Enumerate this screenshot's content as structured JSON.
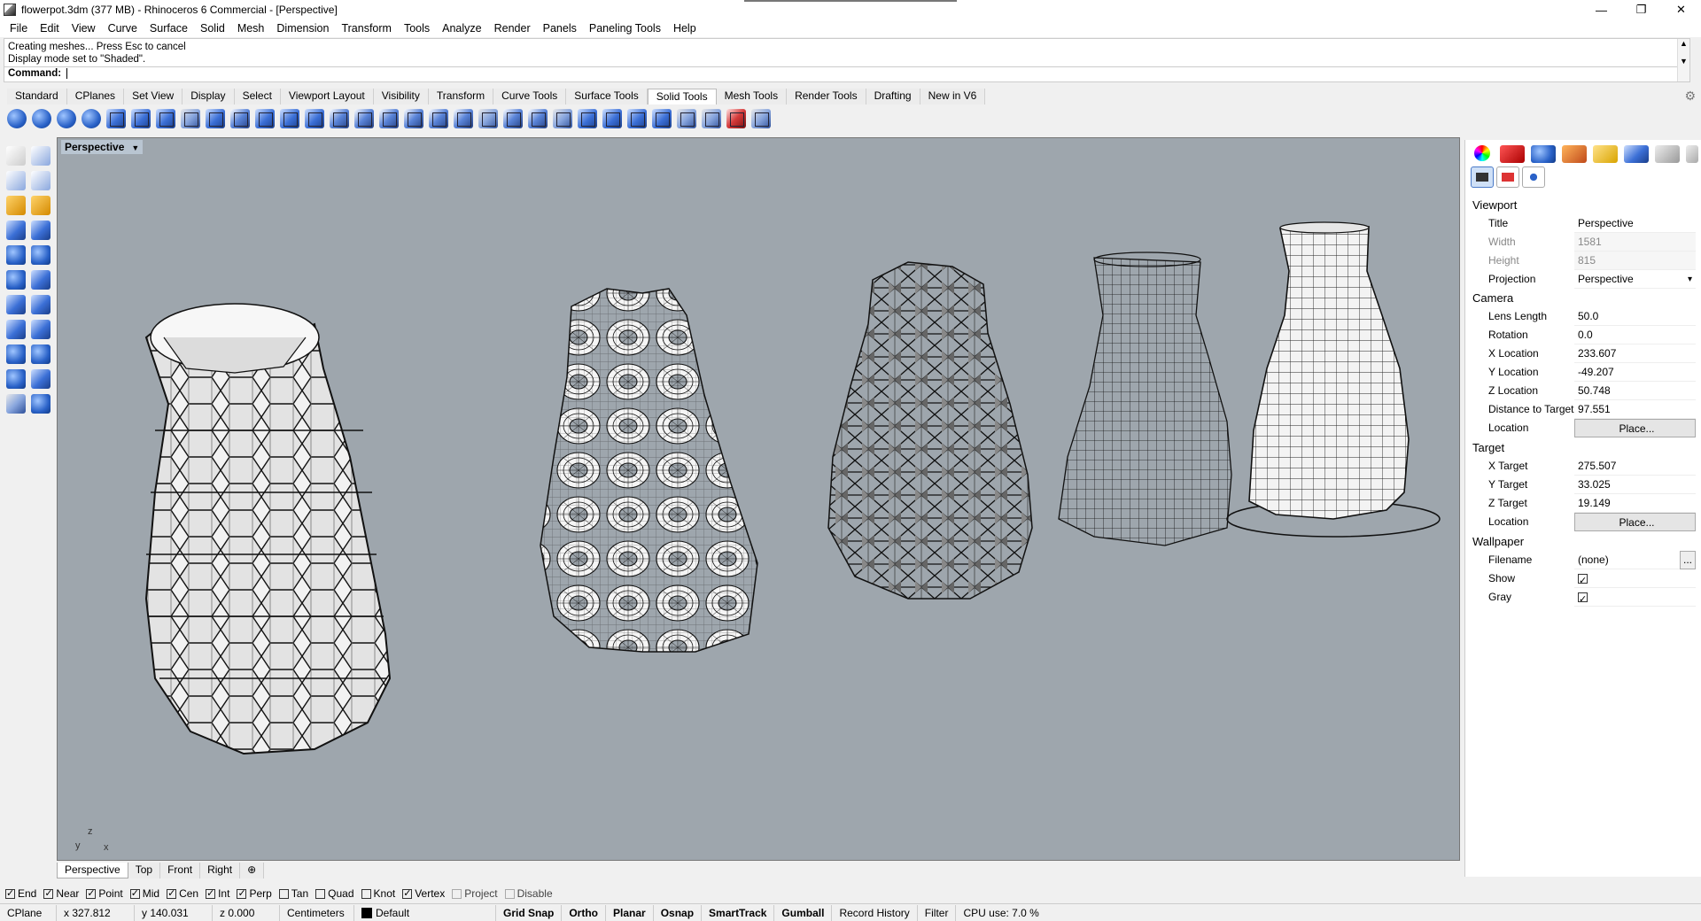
{
  "window": {
    "title": "flowerpot.3dm (377 MB) - Rhinoceros 6 Commercial - [Perspective]",
    "controls": [
      "—",
      "❐",
      "✕"
    ]
  },
  "menu": [
    "File",
    "Edit",
    "View",
    "Curve",
    "Surface",
    "Solid",
    "Mesh",
    "Dimension",
    "Transform",
    "Tools",
    "Analyze",
    "Render",
    "Panels",
    "Paneling Tools",
    "Help"
  ],
  "command": {
    "history": [
      "Creating meshes... Press Esc to cancel",
      "Display mode set to \"Shaded\"."
    ],
    "prompt": "Command:",
    "value": ""
  },
  "toolbar_tabs": [
    "Standard",
    "CPlanes",
    "Set View",
    "Display",
    "Select",
    "Viewport Layout",
    "Visibility",
    "Transform",
    "Curve Tools",
    "Surface Tools",
    "Solid Tools",
    "Mesh Tools",
    "Render Tools",
    "Drafting",
    "New in V6"
  ],
  "active_tab": "Solid Tools",
  "toolbar_icons": [
    "boolean-union-icon",
    "boolean-difference-icon",
    "boolean-intersection-icon",
    "boolean-split-icon",
    "box-edit-icon",
    "fillet-edges-icon",
    "chamfer-edges-icon",
    "shell-icon",
    "cap-planar-holes-icon",
    "extract-surface-icon",
    "merge-faces-icon",
    "extrude-face-icon",
    "move-face-icon",
    "split-face-icon",
    "fold-face-icon",
    "move-edge-icon",
    "move-untrimmed-edge-icon",
    "split-edge-icon",
    "merge-edge-icon",
    "join-edge-icon",
    "rebuild-edges-icon",
    "create-solid-icon",
    "wire-cut-icon",
    "make-hole-icon",
    "hole-array-icon",
    "move-hole-icon",
    "rotate-hole-icon",
    "array-hole-icon",
    "polar-array-hole-icon",
    "delete-hole-icon",
    "solid-options-icon"
  ],
  "viewport": {
    "name": "Perspective",
    "axes": {
      "x": "x",
      "y": "y",
      "z": "z"
    },
    "tabs": [
      "Perspective",
      "Top",
      "Front",
      "Right"
    ],
    "add_tab": "⊕"
  },
  "panel": {
    "viewport_section": "Viewport",
    "title_label": "Title",
    "title_value": "Perspective",
    "width_label": "Width",
    "width_value": "1581",
    "height_label": "Height",
    "height_value": "815",
    "projection_label": "Projection",
    "projection_value": "Perspective",
    "camera_section": "Camera",
    "lens_label": "Lens Length",
    "lens_value": "50.0",
    "rotation_label": "Rotation",
    "rotation_value": "0.0",
    "xloc_label": "X Location",
    "xloc_value": "233.607",
    "yloc_label": "Y Location",
    "yloc_value": "-49.207",
    "zloc_label": "Z Location",
    "zloc_value": "50.748",
    "dist_label": "Distance to Target",
    "dist_value": "97.551",
    "location_label": "Location",
    "place_label": "Place...",
    "target_section": "Target",
    "xt_label": "X Target",
    "xt_value": "275.507",
    "yt_label": "Y Target",
    "yt_value": "33.025",
    "zt_label": "Z Target",
    "zt_value": "19.149",
    "wallpaper_section": "Wallpaper",
    "filename_label": "Filename",
    "filename_value": "(none)",
    "browse_label": "...",
    "show_label": "Show",
    "gray_label": "Gray"
  },
  "osnaps": [
    {
      "label": "End",
      "checked": true
    },
    {
      "label": "Near",
      "checked": true
    },
    {
      "label": "Point",
      "checked": true
    },
    {
      "label": "Mid",
      "checked": true
    },
    {
      "label": "Cen",
      "checked": true
    },
    {
      "label": "Int",
      "checked": true
    },
    {
      "label": "Perp",
      "checked": true
    },
    {
      "label": "Tan",
      "checked": false
    },
    {
      "label": "Quad",
      "checked": false
    },
    {
      "label": "Knot",
      "checked": false
    },
    {
      "label": "Vertex",
      "checked": true
    },
    {
      "label": "Project",
      "checked": false
    },
    {
      "label": "Disable",
      "checked": false
    }
  ],
  "status": {
    "cplane": "CPlane",
    "x": "x 327.812",
    "y": "y 140.031",
    "z": "z 0.000",
    "units": "Centimeters",
    "layer": "Default",
    "grid_snap": "Grid Snap",
    "ortho": "Ortho",
    "planar": "Planar",
    "osnap": "Osnap",
    "smarttrack": "SmartTrack",
    "gumball": "Gumball",
    "record_history": "Record History",
    "filter": "Filter",
    "cpu": "CPU use: 7.0 %"
  },
  "colors": {
    "viewport_bg": "#9ea6ad",
    "accent": "#2a62c8"
  }
}
